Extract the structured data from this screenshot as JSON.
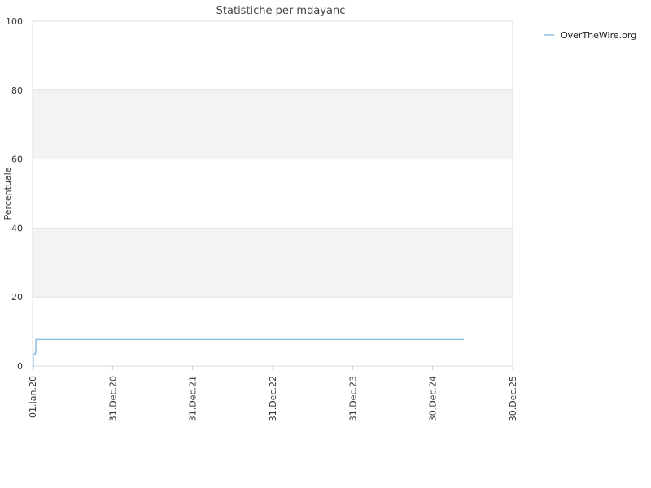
{
  "chart_data": {
    "type": "line",
    "title": "Statistiche per mdayanc",
    "ylabel": "Percentuale",
    "xlabel": "",
    "ylim": [
      0,
      100
    ],
    "yticks": [
      0,
      20,
      40,
      60,
      80,
      100
    ],
    "xlim": [
      "2020-01-01",
      "2025-12-30"
    ],
    "xticks": [
      "2020-01-01",
      "2020-12-31",
      "2021-12-31",
      "2022-12-31",
      "2023-12-31",
      "2024-12-30",
      "2025-12-30"
    ],
    "xtick_labels": [
      "01.Jan.20",
      "31.Dec.20",
      "31.Dec.21",
      "31.Dec.22",
      "31.Dec.23",
      "30.Dec.24",
      "30.Dec.25"
    ],
    "grid": true,
    "legend_position": "top-right",
    "series": [
      {
        "name": "OverTheWire.org",
        "color": "#8fbfe0",
        "step": true,
        "points": [
          {
            "x": "2020-01-01",
            "y": 0
          },
          {
            "x": "2020-01-04",
            "y": 3.5
          },
          {
            "x": "2020-01-13",
            "y": 4.0
          },
          {
            "x": "2020-01-16",
            "y": 7.7
          },
          {
            "x": "2025-05-21",
            "y": 7.7
          }
        ]
      }
    ]
  }
}
